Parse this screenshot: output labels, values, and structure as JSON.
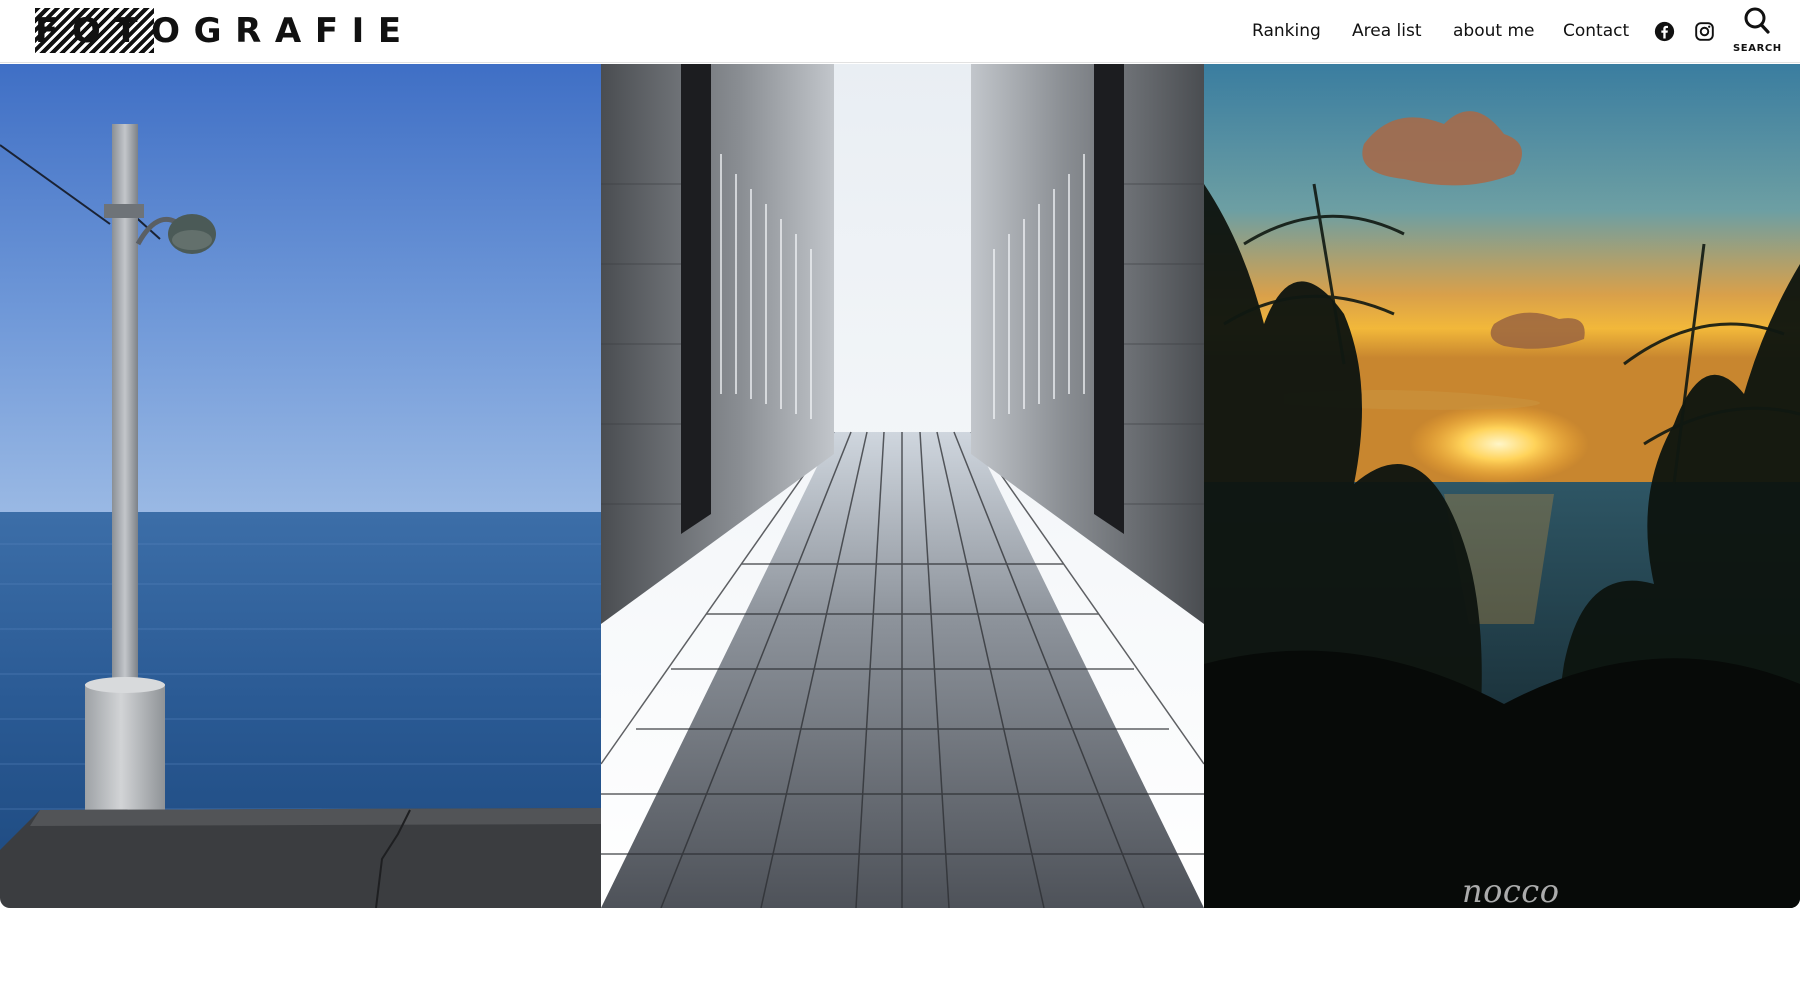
{
  "brand": {
    "logo_text": "FOTOGRAFIE"
  },
  "nav": {
    "items": [
      {
        "label": "Ranking"
      },
      {
        "label": "Area list"
      },
      {
        "label": "about me"
      },
      {
        "label": "Contact"
      }
    ],
    "social": [
      {
        "icon": "facebook-icon"
      },
      {
        "icon": "instagram-icon"
      }
    ],
    "search_label": "SEARCH"
  },
  "hero": {
    "panels": [
      {
        "subject": "lamp post by the sea"
      },
      {
        "subject": "mirrored corridor between buildings"
      },
      {
        "subject": "sunset over the sea through foliage"
      }
    ],
    "watermark": "nocco"
  },
  "colors": {
    "accent": "#111111",
    "header_bg": "#ffffff"
  }
}
